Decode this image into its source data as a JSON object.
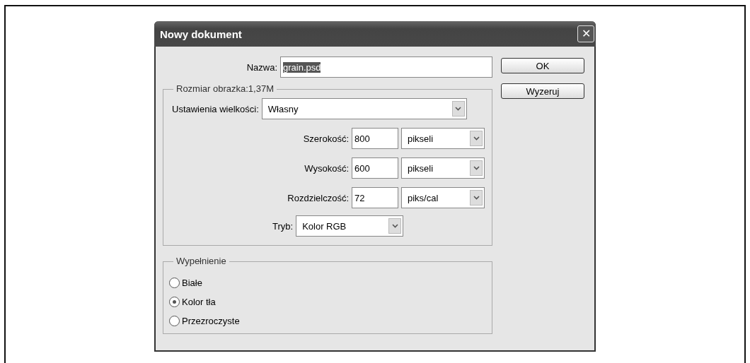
{
  "window": {
    "title": "Nowy dokument",
    "close": "✕"
  },
  "name": {
    "label": "Nazwa:",
    "value": "grain.psd"
  },
  "buttons": [
    "OK",
    "Wyzeruj"
  ],
  "size_group": {
    "title": "Rozmiar obrazka:1,37M",
    "preset": {
      "label": "Ustawienia wielkości:",
      "value": "Własny"
    },
    "fields": [
      {
        "label": "Szerokość:",
        "value": "800",
        "unit": "pikseli"
      },
      {
        "label": "Wysokość:",
        "value": "600",
        "unit": "pikseli"
      },
      {
        "label": "Rozdzielczość:",
        "value": "72",
        "unit": "piks/cal"
      }
    ],
    "mode": {
      "label": "Tryb:",
      "value": "Kolor RGB"
    }
  },
  "fill_group": {
    "title": "Wypełnienie",
    "options": [
      {
        "label": "Białe",
        "selected": false
      },
      {
        "label": "Kolor tła",
        "selected": true
      },
      {
        "label": "Przezroczyste",
        "selected": false
      }
    ]
  }
}
